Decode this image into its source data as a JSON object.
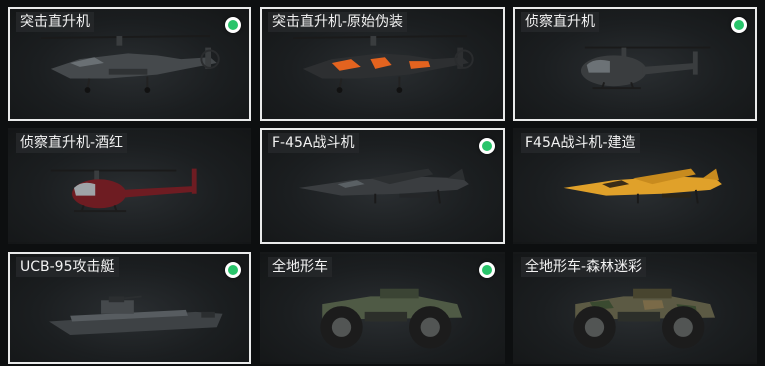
{
  "vehicles": [
    {
      "label": "突击直升机",
      "status_icon": "equipped-indicator-icon",
      "selected": true
    },
    {
      "label": "突击直升机-原始伪装",
      "status_icon": null,
      "selected": true
    },
    {
      "label": "侦察直升机",
      "status_icon": "equipped-indicator-icon",
      "selected": true
    },
    {
      "label": "侦察直升机-酒红",
      "status_icon": null,
      "selected": false
    },
    {
      "label": "F-45A战斗机",
      "status_icon": "equipped-indicator-icon",
      "selected": true
    },
    {
      "label": "F45A战斗机-建造",
      "status_icon": null,
      "selected": false
    },
    {
      "label": "UCB-95攻击艇",
      "status_icon": "equipped-indicator-icon",
      "selected": true
    },
    {
      "label": "全地形车",
      "status_icon": "equipped-indicator-icon",
      "selected": false
    },
    {
      "label": "全地形车-森林迷彩",
      "status_icon": null,
      "selected": false
    }
  ],
  "colors": {
    "indicator_green": "#28c46a",
    "selected_border": "#e9eaea",
    "camo_orange": "#e3631f",
    "burgundy": "#6e1c22",
    "yellow_build": "#e0a12a"
  }
}
